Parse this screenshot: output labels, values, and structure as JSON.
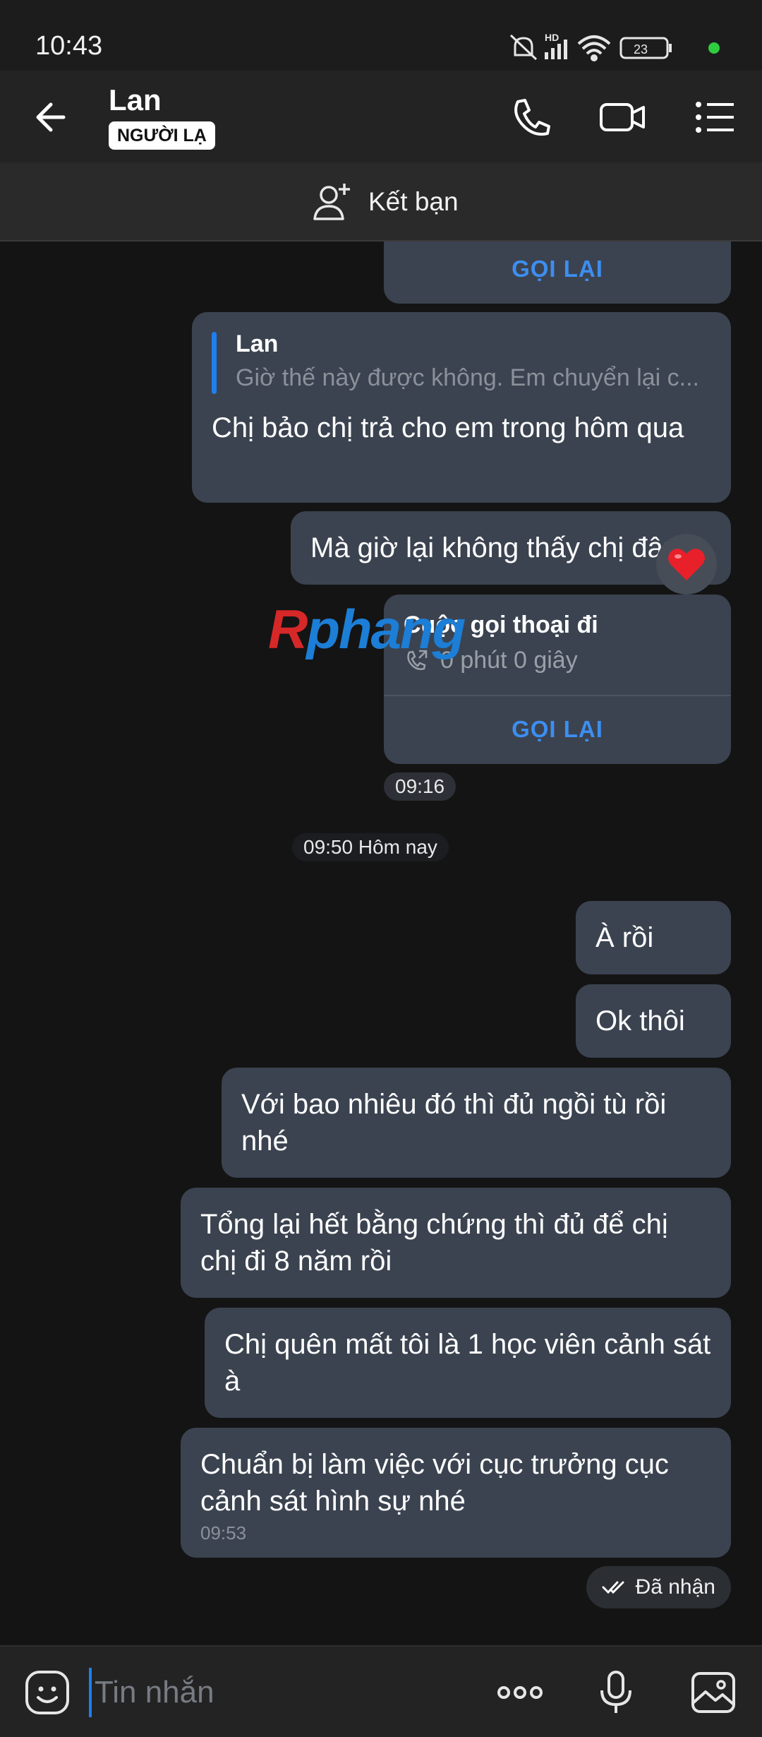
{
  "status_bar": {
    "time": "10:43",
    "hd_label": "HD",
    "battery": "23",
    "icons": [
      "mute-bell-icon",
      "signal-icon",
      "wifi-icon",
      "battery-icon",
      "green-dot"
    ]
  },
  "header": {
    "contact_name": "Lan",
    "badge": "NGƯỜI LẠ",
    "icons": [
      "back-arrow-icon",
      "phone-icon",
      "video-icon",
      "menu-list-icon"
    ]
  },
  "friend_bar": {
    "label": "Kết bạn",
    "icon": "add-friend-icon"
  },
  "messages": {
    "call1_callback": "GỌI LẠI",
    "quote": {
      "name": "Lan",
      "text": "Giờ thế này được không. Em chuyển lại c...",
      "reply": "Chị bảo chị trả cho em trong hôm qua"
    },
    "m_magio": "Mà giờ lại không thấy chị đâu",
    "call2": {
      "title": "Cuộc gọi thoại đi",
      "duration": "0 phút 0 giây",
      "callback": "GỌI LẠI"
    },
    "time_0916": "09:16",
    "date_divider": "09:50 Hôm nay",
    "m_aroi": "À rồi",
    "m_okthoi": "Ok thôi",
    "m_voibao": "Với bao nhiêu đó thì đủ ngồi tù rồi nhé",
    "m_tonglai": "Tổng lại hết bằng chứng thì đủ để chị chị đi 8 năm rồi",
    "m_chiquen": "Chị quên mất tôi là 1 học viên cảnh sát à",
    "m_chuanbi": "Chuẩn bị làm việc với cục trưởng cục cảnh sát hình sự nhé",
    "m_chuanbi_time": "09:53",
    "received_label": "Đã nhận"
  },
  "watermark": {
    "r": "R",
    "rest": "phang"
  },
  "composer": {
    "placeholder": "Tin nhắn",
    "icons": [
      "sticker-icon",
      "more-dots-icon",
      "microphone-icon",
      "image-icon"
    ]
  },
  "colors": {
    "background": "#141414",
    "bubble": "#3b4350",
    "accent_blue": "#3d8ef0",
    "header": "#232323"
  }
}
